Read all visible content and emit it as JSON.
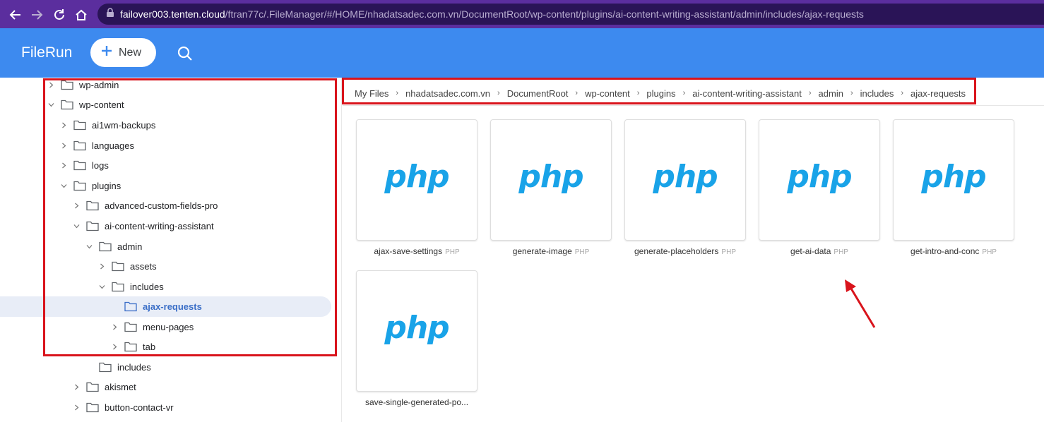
{
  "browser": {
    "url_host": "failover003.tenten.cloud",
    "url_path": "/ftran77c/.FileManager/#/HOME/nhadatsadec.com.vn/DocumentRoot/wp-content/plugins/ai-content-writing-assistant/admin/includes/ajax-requests"
  },
  "app": {
    "title": "FileRun",
    "new_label": "New"
  },
  "sidebar": {
    "items": [
      {
        "label": "wp-admin",
        "expanded": false
      },
      {
        "label": "wp-content",
        "expanded": true
      },
      {
        "label": "ai1wm-backups",
        "expanded": false
      },
      {
        "label": "languages",
        "expanded": false
      },
      {
        "label": "logs",
        "expanded": false
      },
      {
        "label": "plugins",
        "expanded": true
      },
      {
        "label": "advanced-custom-fields-pro",
        "expanded": false
      },
      {
        "label": "ai-content-writing-assistant",
        "expanded": true
      },
      {
        "label": "admin",
        "expanded": true
      },
      {
        "label": "assets",
        "expanded": false
      },
      {
        "label": "includes",
        "expanded": true
      },
      {
        "label": "ajax-requests",
        "selected": true
      },
      {
        "label": "menu-pages",
        "expanded": false
      },
      {
        "label": "tab",
        "expanded": false
      },
      {
        "label": "includes"
      },
      {
        "label": "akismet",
        "expanded": false
      },
      {
        "label": "button-contact-vr",
        "expanded": false
      }
    ]
  },
  "breadcrumb": [
    "My Files",
    "nhadatsadec.com.vn",
    "DocumentRoot",
    "wp-content",
    "plugins",
    "ai-content-writing-assistant",
    "admin",
    "includes",
    "ajax-requests"
  ],
  "files": [
    {
      "name": "ajax-save-settings",
      "ext": "PHP",
      "thumb": "php"
    },
    {
      "name": "generate-image",
      "ext": "PHP",
      "thumb": "php"
    },
    {
      "name": "generate-placeholders",
      "ext": "PHP",
      "thumb": "php"
    },
    {
      "name": "get-ai-data",
      "ext": "PHP",
      "thumb": "php"
    },
    {
      "name": "get-intro-and-conc",
      "ext": "PHP",
      "thumb": "php"
    },
    {
      "name": "save-single-generated-po...",
      "ext": "",
      "thumb": "php"
    }
  ],
  "colors": {
    "browser_bar": "#5b2e9e",
    "header": "#3d8aef",
    "php_logo": "#19a3e8",
    "annotation": "#d9141c",
    "selected": "#3a6ec7"
  }
}
